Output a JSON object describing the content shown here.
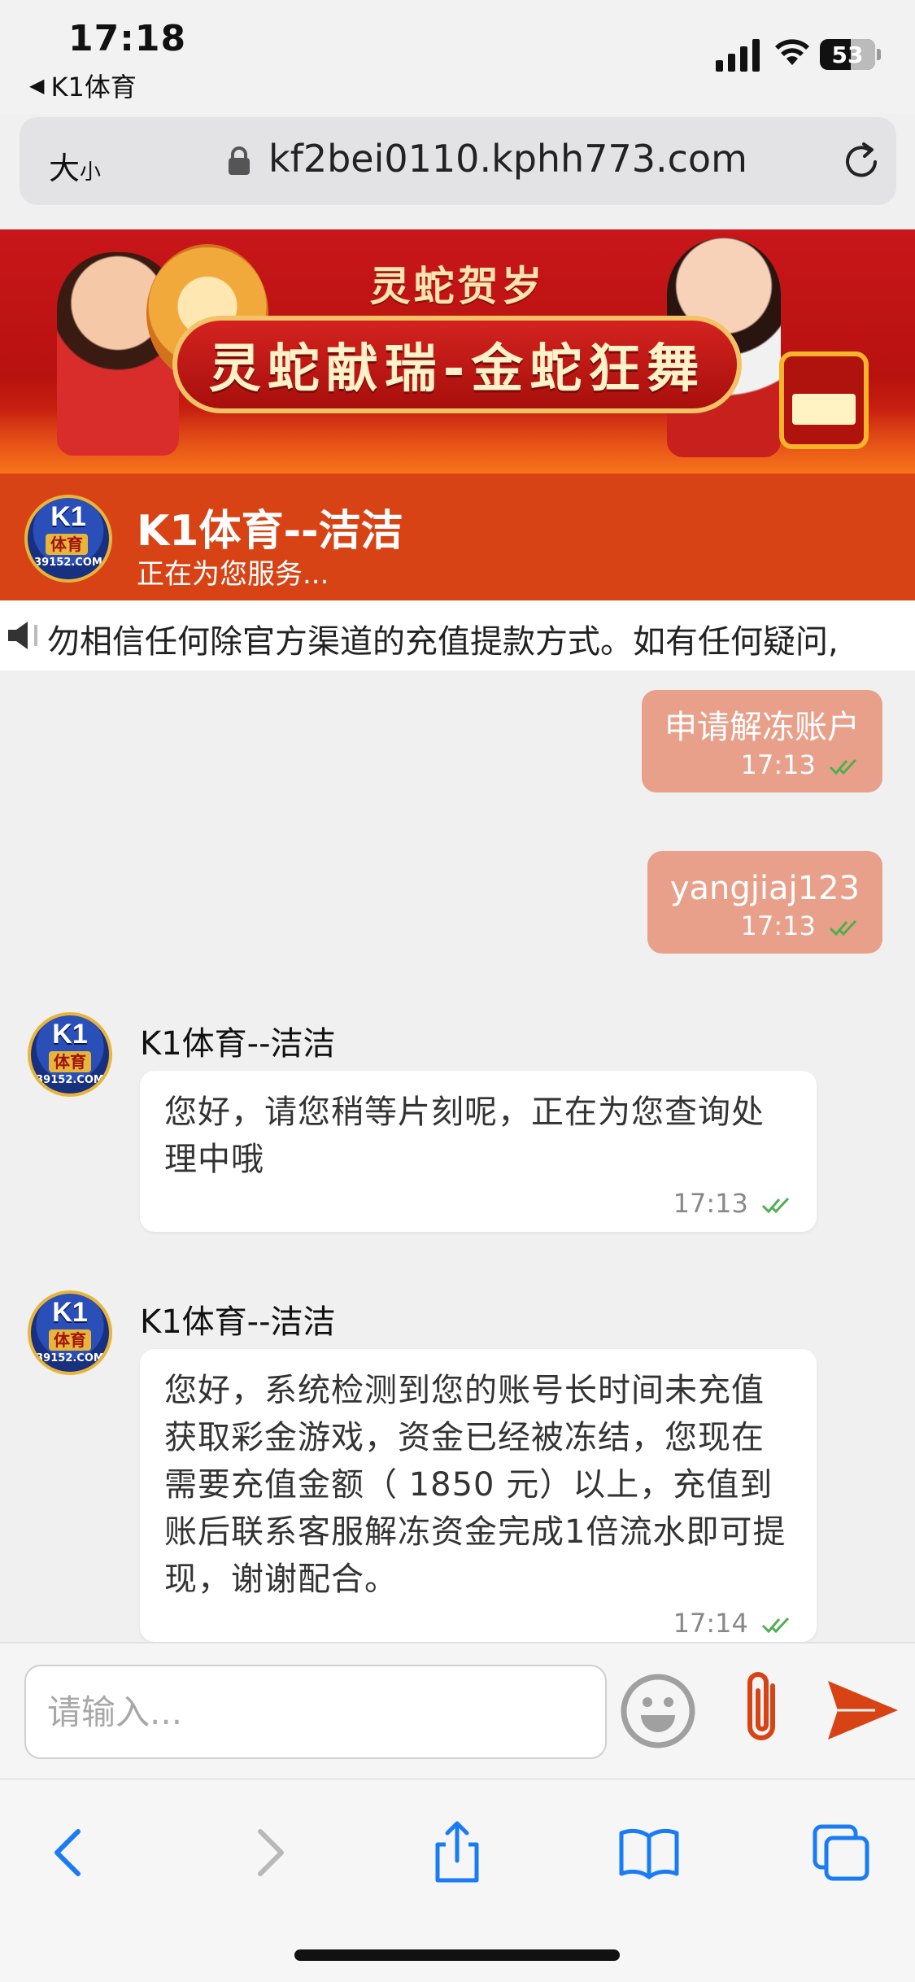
{
  "status_bar": {
    "time": "17:18",
    "back_app": "K1体育",
    "battery": "53"
  },
  "browser": {
    "font_size_label_big": "大",
    "font_size_label_small": "小",
    "url": "kf2bei0110.kphh773.com"
  },
  "banner": {
    "small_text": "灵蛇贺岁",
    "headline": "灵蛇献瑞-金蛇狂舞"
  },
  "chat_header": {
    "agent_name": "K1体育--洁洁",
    "status": "正在为您服务...",
    "color": "#d84315"
  },
  "avatar": {
    "brand": "K1",
    "cn": "体育",
    "domain": "39152.COM"
  },
  "marquee": {
    "text": "勿相信任何除官方渠道的充值提款方式。如有任何疑问,"
  },
  "messages": [
    {
      "from": "user",
      "text": "申请解冻账户",
      "time": "17:13"
    },
    {
      "from": "user",
      "text": "yangjiaj123",
      "time": "17:13"
    },
    {
      "from": "agent",
      "name": "K1体育--洁洁",
      "text": "您好，请您稍等片刻呢，正在为您查询处理中哦",
      "time": "17:13"
    },
    {
      "from": "agent",
      "name": "K1体育--洁洁",
      "text": "您好，系统检测到您的账号长时间未充值获取彩金游戏，资金已经被冻结，您现在需要充值金额（ 1850 元）以上，充值到账后联系客服解冻资金完成1倍流水即可提现，谢谢配合。",
      "time": "17:14"
    }
  ],
  "input": {
    "placeholder": "请输入..."
  },
  "colors": {
    "user_bubble": "#e8a08b",
    "send": "#d84315",
    "check": "#4caf50",
    "ios_blue": "#1a7cf5"
  }
}
